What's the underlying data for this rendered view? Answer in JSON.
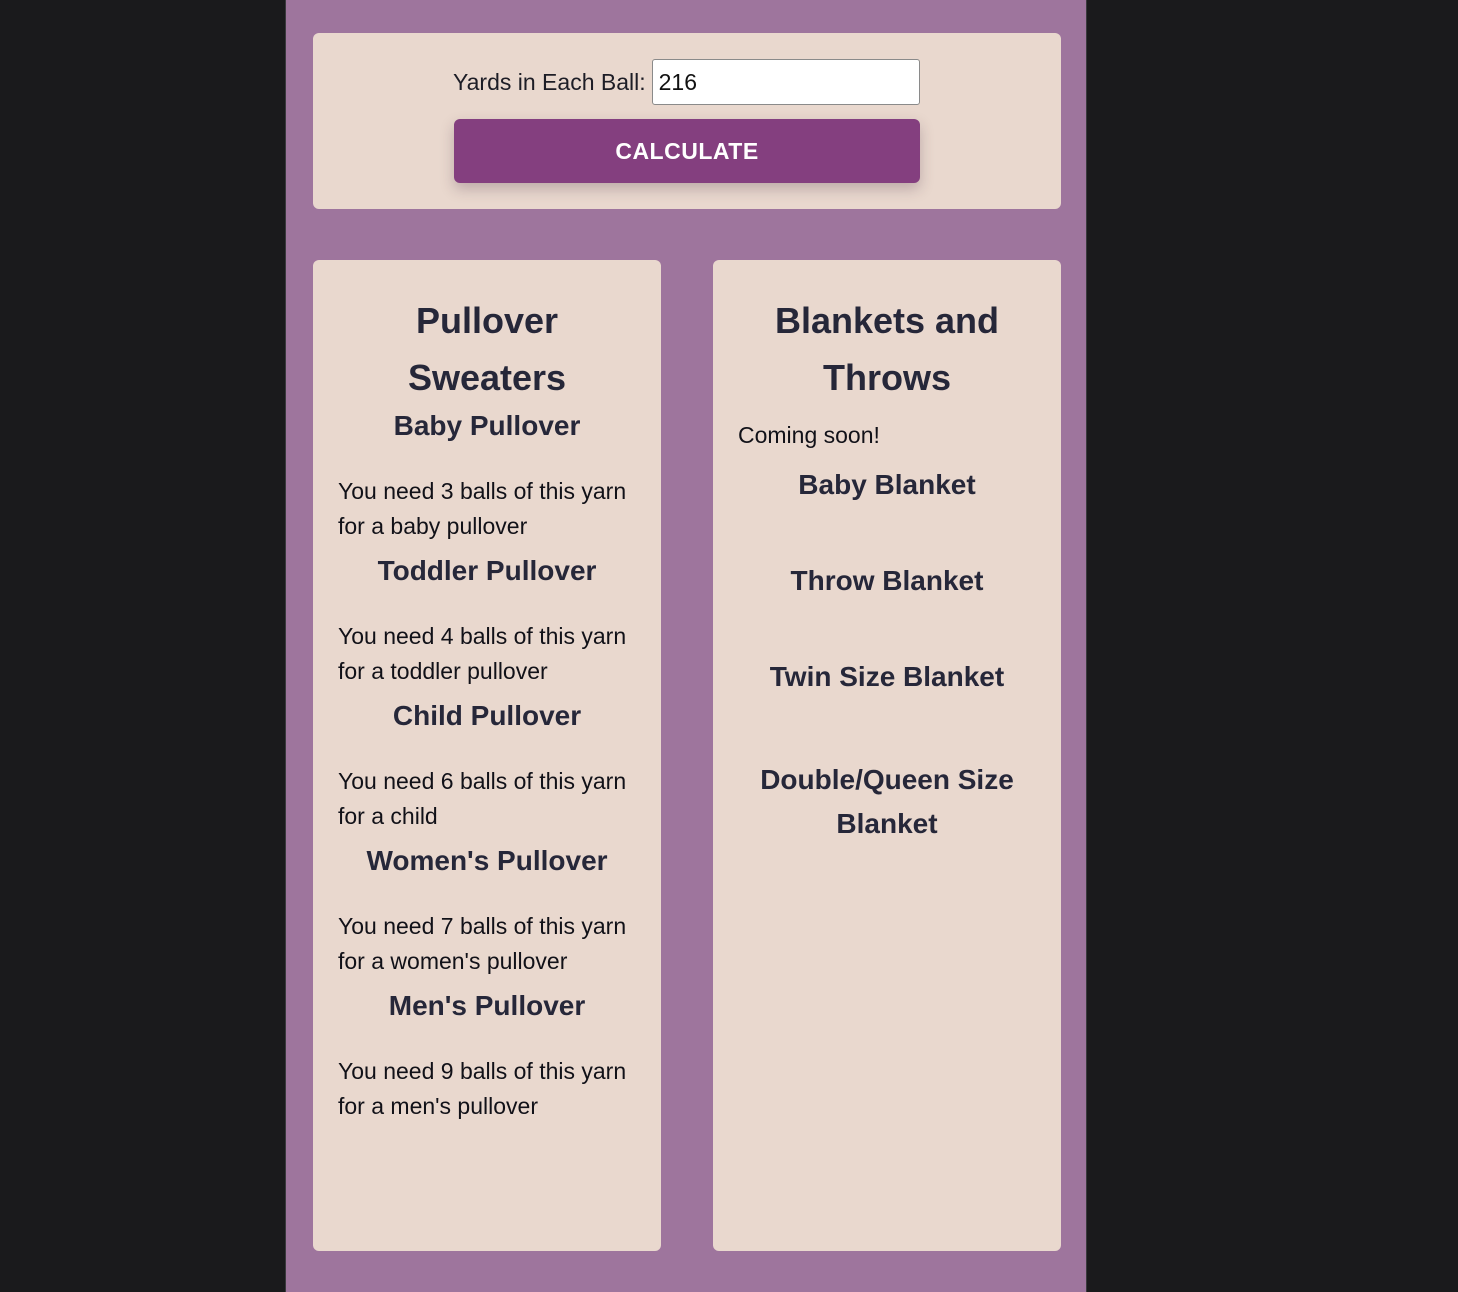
{
  "calculator": {
    "yards_label": "Yards in Each Ball:",
    "yards_value": "216",
    "calculate_label": "CALCULATE"
  },
  "pullovers": {
    "title": "Pullover Sweaters",
    "items": [
      {
        "name": "Baby Pullover",
        "result": "You need 3 balls of this yarn for a baby pullover"
      },
      {
        "name": "Toddler Pullover",
        "result": "You need 4 balls of this yarn for a toddler pullover"
      },
      {
        "name": "Child Pullover",
        "result": "You need 6 balls of this yarn for a child"
      },
      {
        "name": "Women's Pullover",
        "result": "You need 7 balls of this yarn for a women's pullover"
      },
      {
        "name": "Men's Pullover",
        "result": "You need 9 balls of this yarn for a men's pullover"
      }
    ]
  },
  "blankets": {
    "title": "Blankets and Throws",
    "note": "Coming soon!",
    "items": [
      {
        "name": "Baby Blanket"
      },
      {
        "name": "Throw Blanket"
      },
      {
        "name": "Twin Size Blanket"
      },
      {
        "name": "Double/Queen Size Blanket"
      }
    ]
  },
  "colors": {
    "page_background": "#1a1a1c",
    "column_background": "#9e759d",
    "card_background": "#e9d8ce",
    "button_background": "#843f7f",
    "heading_text": "#262739"
  }
}
